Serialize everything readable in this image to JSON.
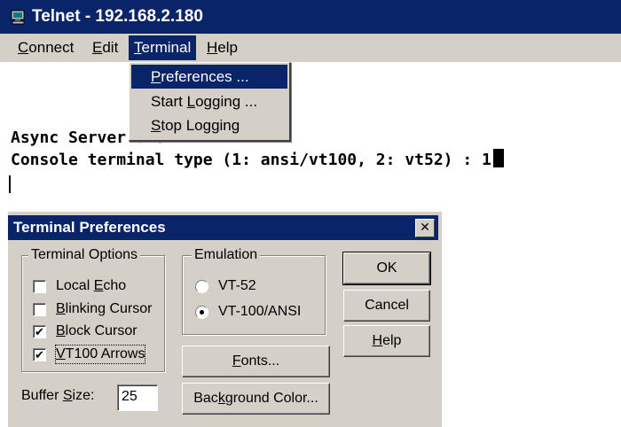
{
  "telnet": {
    "title": "Telnet - 192.168.2.180",
    "menu": [
      {
        "ul": "C",
        "rest": "onnect"
      },
      {
        "ul": "E",
        "rest": "dit"
      },
      {
        "ul": "T",
        "rest": "erminal"
      },
      {
        "ul": "H",
        "rest": "elp"
      }
    ],
    "terminal_menu": [
      {
        "ul": "P",
        "rest": "references ...",
        "highlighted": true
      },
      {
        "pre": "Start ",
        "ul": "L",
        "rest": "ogging ..."
      },
      {
        "ul": "S",
        "rest": "top Logging"
      }
    ],
    "terminal_lines": [
      "Async Server Shell>",
      "Console terminal type (1: ansi/vt100, 2: vt52) : 1"
    ]
  },
  "dialog": {
    "title": "Terminal Preferences",
    "close_icon": "close-icon",
    "terminal_options": {
      "label": "Terminal Options",
      "items": [
        {
          "pre": "Local ",
          "ul": "E",
          "rest": "cho",
          "checked": false,
          "mark": ""
        },
        {
          "pre": "",
          "ul": "B",
          "rest": "linking Cursor",
          "checked": false,
          "mark": ""
        },
        {
          "pre": "",
          "ul": "B",
          "rest": "lock Cursor",
          "checked": true,
          "mark": "✔"
        },
        {
          "pre": "",
          "ul": "V",
          "rest": "T100 Arrows",
          "checked": true,
          "mark": "✔"
        }
      ]
    },
    "emulation": {
      "label": "Emulation",
      "options": [
        {
          "text": "VT-52",
          "selected": false
        },
        {
          "text": "VT-100/ANSI",
          "selected": true
        }
      ]
    },
    "buffer_size": {
      "pre": "Buffer ",
      "ul": "S",
      "rest": "ize:",
      "value": "25"
    },
    "buttons": {
      "ok": "OK",
      "cancel": "Cancel",
      "help": {
        "ul": "H",
        "rest": "elp"
      },
      "fonts": {
        "ul": "F",
        "rest": "onts..."
      },
      "bg_color": {
        "pre": "Bac",
        "ul": "k",
        "rest": "ground Color..."
      }
    }
  },
  "colors": {
    "title_bar": "#0a246a",
    "face": "#d4d0c8",
    "highlight": "#0a246a"
  }
}
